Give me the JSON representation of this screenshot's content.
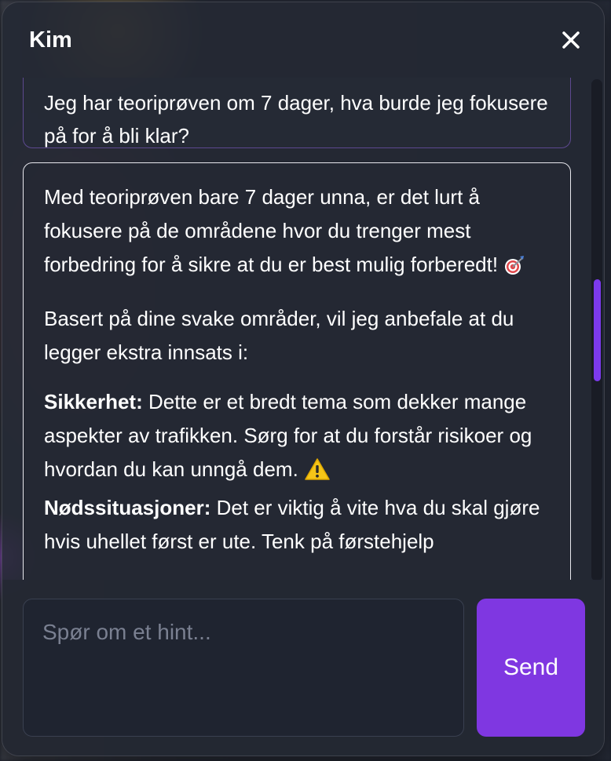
{
  "chat": {
    "title": "Kim",
    "messages": {
      "user_question": "Jeg har teoriprøven om 7 dager, hva burde jeg fokusere på for å bli klar?",
      "bot": {
        "intro": "Med teoriprøven bare 7 dager unna, er det lurt å fokusere på de områdene hvor du trenger mest forbedring for å sikre at du er best mulig forberedt!",
        "weak_areas": "Basert på dine svake områder, vil jeg anbefale at du legger ekstra innsats i:",
        "topic_1_title": "Sikkerhet:",
        "topic_1_text": "Dette er et bredt tema som dekker mange aspekter av trafikken. Sørg for at du forstår risikoer og hvordan du kan unngå dem.",
        "topic_2_title": "Nødssituasjoner:",
        "topic_2_text": "Det er viktig å vite hva du skal gjøre hvis uhellet først er ute. Tenk på førstehjelp"
      }
    },
    "composer": {
      "placeholder": "Spør om et hint...",
      "value": "",
      "send_label": "Send"
    }
  },
  "icons": {
    "close": "close-icon",
    "target": "target-emoji-icon",
    "warning": "warning-emoji-icon"
  },
  "colors": {
    "accent": "#7f37e1",
    "panel": "#242833",
    "user_border": "#8c64dc",
    "scroll_thumb": "#7c3aed"
  }
}
